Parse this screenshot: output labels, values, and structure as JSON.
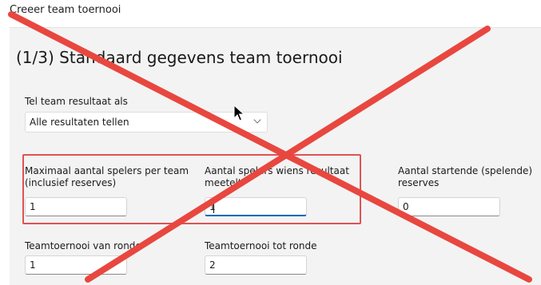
{
  "window": {
    "title": "Creeer team toernooi"
  },
  "page": {
    "heading": "(1/3) Standaard gegevens team toernooi"
  },
  "count_results": {
    "label": "Tel team resultaat als",
    "selected": "Alle resultaten tellen"
  },
  "fields": {
    "max_players": {
      "label_line1": "Maximaal aantal spelers per team",
      "label_line2": "(inclusief reserves)",
      "value": "1"
    },
    "counting_players": {
      "label_line1": "Aantal spelers wiens resultaat",
      "label_line2": "meetelt",
      "value": "1"
    },
    "starting_reserves": {
      "label_line1": "Aantal startende (spelende)",
      "label_line2": "reserves",
      "value": "0"
    },
    "from_round": {
      "label": "Teamtoernooi van ronde",
      "value": "1"
    },
    "to_round": {
      "label": "Teamtoernooi tot ronde",
      "value": "2"
    }
  },
  "colors": {
    "cross": "#e8473f",
    "highlight": "#e05252",
    "focus": "#0067c0"
  }
}
